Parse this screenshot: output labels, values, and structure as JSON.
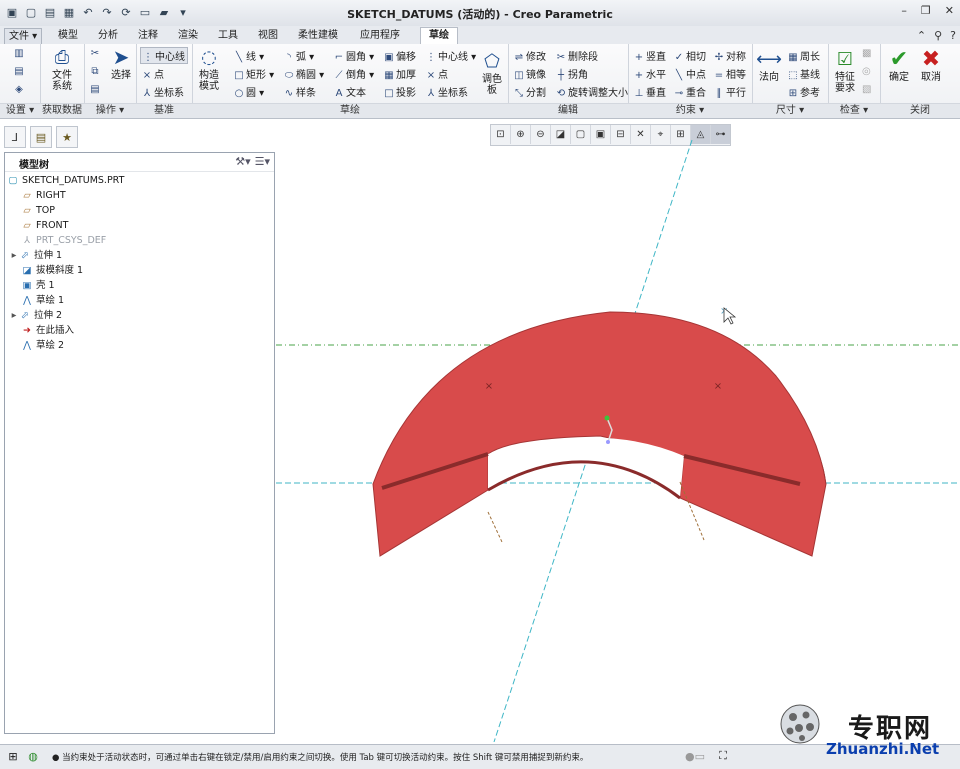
{
  "window": {
    "title": "SKETCH_DATUMS (活动的) - Creo Parametric"
  },
  "tabs": [
    "文件",
    "模型",
    "分析",
    "注释",
    "渲染",
    "工具",
    "视图",
    "柔性建模",
    "应用程序",
    "草绘"
  ],
  "ribbon": {
    "settings_group": "设置",
    "get_data_group": "获取数据",
    "get_data_btn": "文件\n系统",
    "operations_group": "操作",
    "select_btn": "选择",
    "datum_group": "基准",
    "datum": {
      "centerline": "中心线",
      "point": "点",
      "csys": "坐标系"
    },
    "sketch_group": "草绘",
    "construction_mode": "构造\n模式",
    "sketch": {
      "line": "线",
      "arc": "弧",
      "fillet": "圆角",
      "offset": "偏移",
      "centerline": "中心线",
      "rectangle": "矩形",
      "ellipse": "椭圆",
      "chamfer": "倒角",
      "thicken": "加厚",
      "point": "点",
      "circle": "圆",
      "spline": "样条",
      "text": "文本",
      "project": "投影",
      "csys": "坐标系"
    },
    "palette": "调色\n板",
    "edit_group": "编辑",
    "edit": {
      "modify": "修改",
      "delete_segment": "删除段",
      "mirror": "镜像",
      "corner": "拐角",
      "divide": "分割",
      "rotate_resize": "旋转调整大小"
    },
    "constrain_group": "约束",
    "constrain": {
      "vertical": "竖直",
      "tangent": "相切",
      "symmetric": "对称",
      "horizontal": "水平",
      "midpoint": "中点",
      "equal": "相等",
      "perpendicular": "垂直",
      "coincident": "重合",
      "parallel": "平行"
    },
    "dimension_group": "尺寸",
    "dimension": {
      "normal": "法向",
      "perimeter": "周长",
      "baseline": "基线",
      "reference": "参考"
    },
    "inspect_group": "检查",
    "feature_req": "特征\n要求",
    "close_group": "关闭",
    "ok": "确定",
    "cancel": "取消"
  },
  "model_tree": {
    "header": "模型树",
    "items": [
      "SKETCH_DATUMS.PRT",
      "RIGHT",
      "TOP",
      "FRONT",
      "PRT_CSYS_DEF",
      "拉伸 1",
      "拔模斜度 1",
      "壳 1",
      "草绘 1",
      "拉伸 2",
      "在此插入",
      "草绘 2"
    ]
  },
  "status": {
    "message": "● 当约束处于活动状态时，可通过单击右键在锁定/禁用/启用约束之间切换。使用 Tab 键可切换活动约束。按住 Shift 键可禁用捕捉到新约束。"
  },
  "watermark": {
    "zh": "专职网",
    "en": "Zhuanzhi.Net"
  },
  "colors": {
    "part_face": "#d84b4b",
    "part_side": "#7a2424",
    "datum_cyan": "#3fb6c6",
    "datum_green": "#4aa34a"
  }
}
